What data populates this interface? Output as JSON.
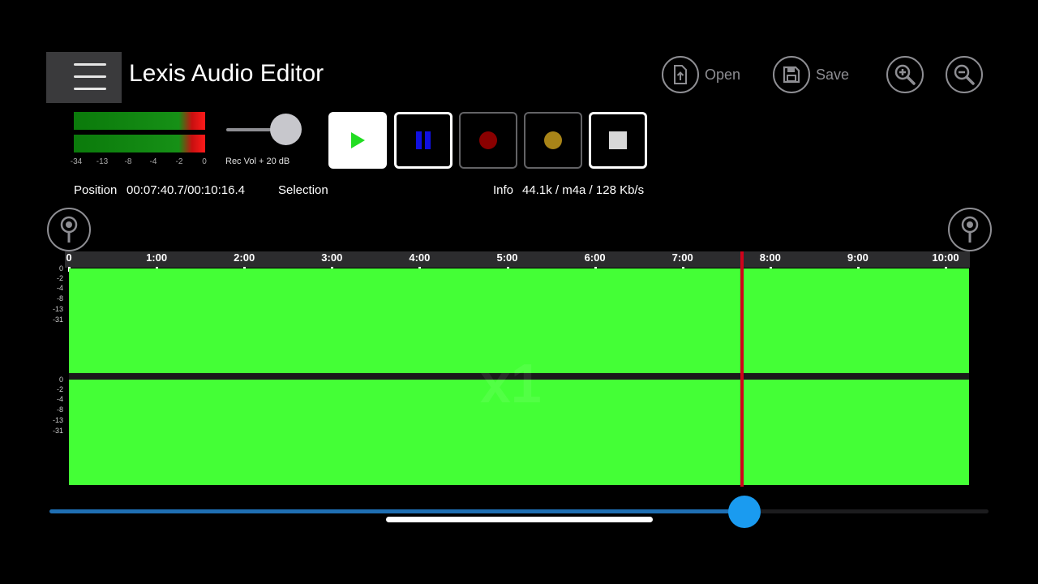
{
  "header": {
    "title": "Lexis Audio Editor",
    "open_label": "Open",
    "save_label": "Save"
  },
  "meter": {
    "scale": [
      "-34",
      "-13",
      "-8",
      "-4",
      "-2",
      "0"
    ]
  },
  "rec_volume": {
    "label": "Rec Vol + 20 dB",
    "level": 0.75
  },
  "transport": {
    "buttons": [
      "play",
      "pause",
      "record",
      "record-pause",
      "stop"
    ]
  },
  "status": {
    "position_label": "Position",
    "position_value": "00:07:40.7/00:10:16.4",
    "selection_label": "Selection",
    "info_label": "Info",
    "info_value": "44.1k / m4a / 128 Kb/s"
  },
  "timeline": {
    "ticks": [
      "0",
      "1:00",
      "2:00",
      "3:00",
      "4:00",
      "5:00",
      "6:00",
      "7:00",
      "8:00",
      "9:00",
      "10:00"
    ]
  },
  "waveform": {
    "db_labels": [
      "0",
      "-2",
      "-4",
      "-8",
      "-13",
      "-31"
    ],
    "zoom_watermark": "x1",
    "playhead_time": "00:07:40.7"
  },
  "scroll": {
    "fraction": 0.746
  },
  "colors": {
    "waveform": "#44ff36",
    "playhead": "#d0021b",
    "accent": "#1a9bf0",
    "play_icon": "#22dd22",
    "pause_icon": "#1010e0",
    "record_icon": "#8a0000",
    "record_pause_icon": "#a88418"
  }
}
